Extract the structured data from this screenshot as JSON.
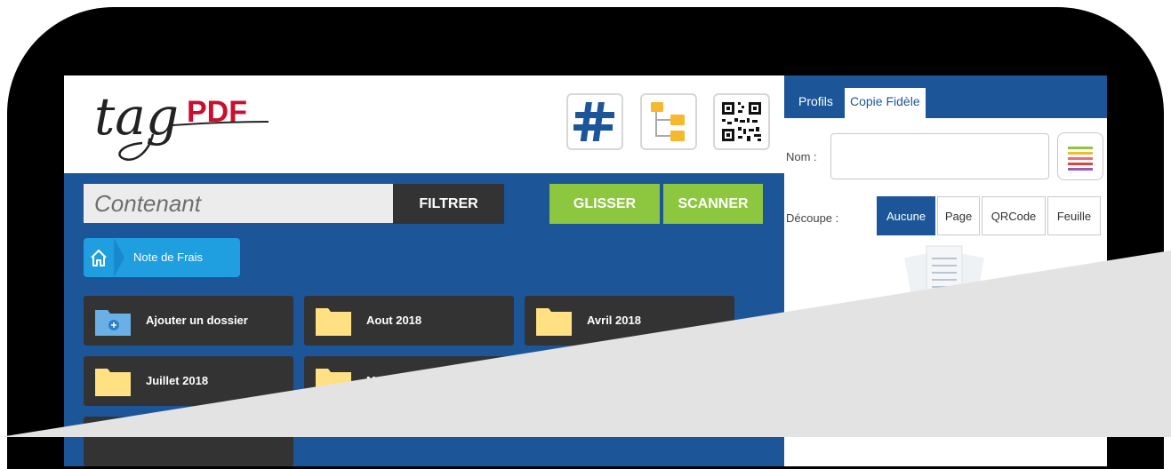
{
  "logo": {
    "script": "tag",
    "pdf": "PDF"
  },
  "toolbar": {
    "hashtag_icon": "hashtag-icon",
    "tree_icon": "folder-tree-icon",
    "qr_icon": "qr-code-icon"
  },
  "search": {
    "placeholder": "Contenant"
  },
  "buttons": {
    "filter": "FILTRER",
    "glisser": "GLISSER",
    "scanner": "SCANNER"
  },
  "breadcrumb": {
    "home_icon": "home-icon",
    "current": "Note de Frais"
  },
  "folders": [
    {
      "label": "Ajouter un dossier",
      "icon": "add-folder-icon"
    },
    {
      "label": "Aout 2018",
      "icon": "folder-icon"
    },
    {
      "label": "Avril 2018",
      "icon": "folder-icon"
    },
    {
      "label": "Juillet 2018",
      "icon": "folder-icon"
    },
    {
      "label": "M",
      "icon": "folder-icon"
    }
  ],
  "right": {
    "tabs": [
      "Profils",
      "Copie Fidèle"
    ],
    "nom_label": "Nom :",
    "nom_value": "",
    "decoupe_label": "Découpe :",
    "decoupe_options": [
      "Aucune",
      "Page",
      "QRCode",
      "Feuille"
    ],
    "decoupe_selected": "Aucune"
  },
  "colors": {
    "primary": "#1c5699",
    "accent": "#8dc63f",
    "dark": "#333333",
    "breadcrumb": "#1f9ee0",
    "logo_red": "#c8102e",
    "overlay": "#e3e3e3"
  }
}
